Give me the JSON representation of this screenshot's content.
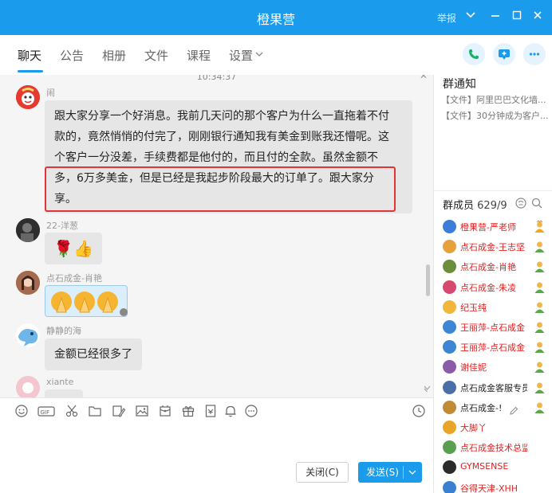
{
  "window": {
    "title": "橙果营",
    "report_label": "举报",
    "dropdown_icon": "chevron-down-icon",
    "minimize_icon": "minimize-icon",
    "maximize_icon": "maximize-icon",
    "close_icon": "close-icon"
  },
  "tabs": [
    {
      "label": "聊天",
      "active": true
    },
    {
      "label": "公告",
      "active": false
    },
    {
      "label": "相册",
      "active": false
    },
    {
      "label": "文件",
      "active": false
    },
    {
      "label": "课程",
      "active": false
    },
    {
      "label": "设置",
      "active": false
    }
  ],
  "header_actions": [
    "phone-icon",
    "screen-share-icon",
    "more-icon"
  ],
  "chat": {
    "timestamp": "10:34:37",
    "messages": [
      {
        "sender": "闹",
        "lines": [
          "跟大家分享一个好消息。我前几天问的那个客户为什么一直拖着不付",
          "款的，竟然悄悄的付完了，刚刚银行通知我有美金到账我还懵呢。这",
          "个客户一分没差，手续费都是他付的，而且付的全款。虽然金额不",
          "多，6万多美金，但是已经是我起步阶段最大的订单了。跟大家分",
          "享。"
        ]
      },
      {
        "sender": "22-洋葱",
        "content": "🌹👍"
      },
      {
        "sender": "点石成金-肖艳",
        "content": "sticker-praying-hands"
      },
      {
        "sender": "静静的海",
        "text": "金额已经很多了"
      },
      {
        "sender": "xiante",
        "text": ""
      }
    ]
  },
  "toolbar_icons": [
    "emoji-icon",
    "gif-icon",
    "scissors-icon",
    "folder-icon",
    "image-edit-icon",
    "picture-icon",
    "red-packet-icon",
    "gift-icon",
    "document-icon",
    "bell-icon",
    "more-circle-icon",
    "history-icon"
  ],
  "buttons": {
    "close_label": "关闭(C)",
    "send_label": "发送(S)"
  },
  "sidebar": {
    "notice_title": "群通知",
    "notices": [
      "【文件】阿里巴巴文化墙...",
      "【文件】30分钟成为客户..."
    ],
    "member_title": "群成员",
    "member_count": "629/9",
    "members": [
      {
        "name": "橙果营-严老师",
        "color": "#e02020"
      },
      {
        "name": "点石成金-王志坚",
        "color": "#e02020"
      },
      {
        "name": "点石成金-肖艳",
        "color": "#e02020"
      },
      {
        "name": "点石成金-朱凌",
        "color": "#e02020"
      },
      {
        "name": "纪玉纯",
        "color": "#e02020"
      },
      {
        "name": "王丽萍-点石成金",
        "color": "#e02020"
      },
      {
        "name": "王丽萍-点石成金",
        "color": "#e02020"
      },
      {
        "name": "谢佳妮",
        "color": "#e02020"
      },
      {
        "name": "点石成金客服专员",
        "color": "#222222"
      },
      {
        "name": "点石成金-!",
        "color": "#222222"
      },
      {
        "name": "大脚丫",
        "color": "#e02020"
      },
      {
        "name": "点石成金技术总监-张",
        "color": "#e02020"
      },
      {
        "name": "GYMSENSE",
        "color": "#e02020"
      },
      {
        "name": "谷得天津-XHH",
        "color": "#e02020"
      }
    ]
  },
  "colors": {
    "accent": "#1a9bec",
    "highlight_border": "#e23434"
  }
}
